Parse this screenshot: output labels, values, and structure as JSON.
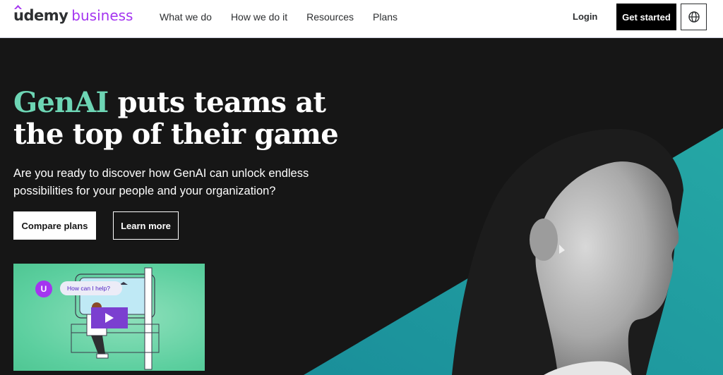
{
  "header": {
    "logo_primary": "udemy",
    "logo_secondary": "business",
    "nav": [
      "What we do",
      "How we do it",
      "Resources",
      "Plans"
    ],
    "login": "Login",
    "get_started": "Get started",
    "globe_icon": "globe-icon"
  },
  "hero": {
    "headline_accent": "GenAI",
    "headline_rest_1": " puts teams at",
    "headline_line_2": "the top of their game",
    "subtext": "Are you ready to discover how GenAI can unlock endless possibilities for your people and your organization?",
    "compare_plans": "Compare plans",
    "learn_more": "Learn more"
  },
  "video": {
    "chat_avatar_letter": "U",
    "chat_text": "How can I help?",
    "play_icon": "play-icon"
  },
  "colors": {
    "brand_purple": "#a435f0",
    "accent_green": "#6dd5b4",
    "teal": "#1f9aa0",
    "background": "#161616"
  }
}
